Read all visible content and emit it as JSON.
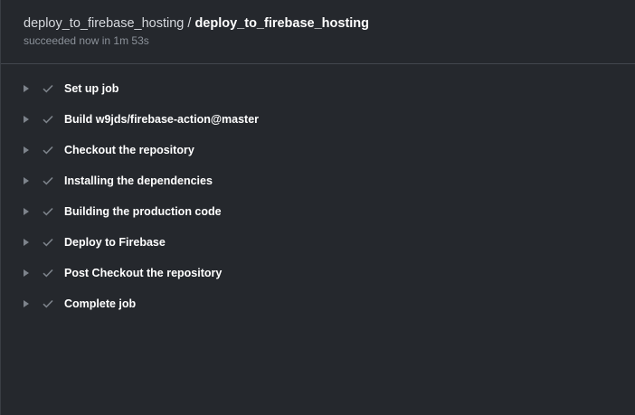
{
  "header": {
    "workflow_name": "deploy_to_firebase_hosting",
    "separator": "/",
    "job_name": "deploy_to_firebase_hosting",
    "status": "succeeded now in 1m 53s"
  },
  "steps": [
    {
      "label": "Set up job",
      "status": "success"
    },
    {
      "label": "Build w9jds/firebase-action@master",
      "status": "success"
    },
    {
      "label": "Checkout the repository",
      "status": "success"
    },
    {
      "label": "Installing the dependencies",
      "status": "success"
    },
    {
      "label": "Building the production code",
      "status": "success"
    },
    {
      "label": "Deploy to Firebase",
      "status": "success"
    },
    {
      "label": "Post Checkout the repository",
      "status": "success"
    },
    {
      "label": "Complete job",
      "status": "success"
    }
  ],
  "colors": {
    "background": "#25282d",
    "text": "#ffffff",
    "muted": "#8b9199",
    "icon": "#7d838b"
  },
  "icons": {
    "expand": "caret-right-icon",
    "status": "check-icon"
  }
}
